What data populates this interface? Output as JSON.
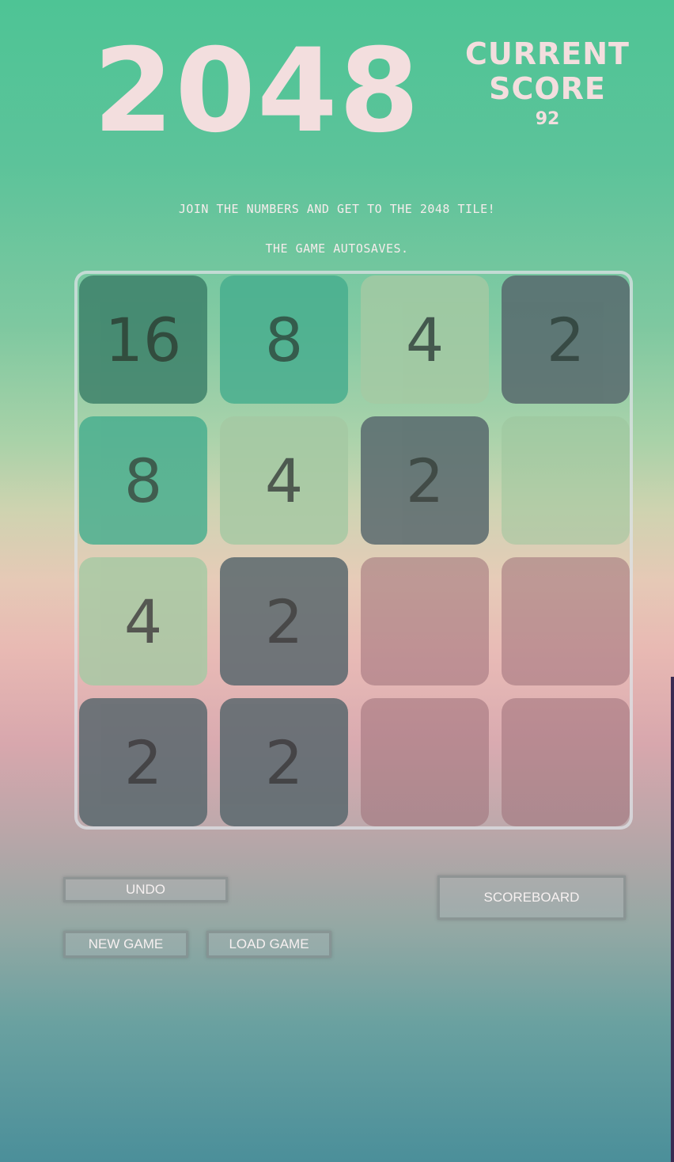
{
  "header": {
    "title": "2048",
    "score_label_line1": "CURRENT",
    "score_label_line2": "SCORE",
    "score_value": "92"
  },
  "info": {
    "line1": "JOIN THE NUMBERS AND GET TO THE 2048 TILE!",
    "line2": "THE GAME AUTOSAVES."
  },
  "board": {
    "size": 4,
    "rows": [
      [
        "16",
        "8",
        "4",
        "2"
      ],
      [
        "8",
        "4",
        "2",
        ""
      ],
      [
        "4",
        "2",
        "",
        ""
      ],
      [
        "2",
        "2",
        "",
        ""
      ]
    ],
    "tile_colors": {
      "2": "#55656b",
      "4": "#a5c9a3",
      "8": "#46ad8e",
      "16": "#3a7e68",
      "empty_top": "#9cc49c",
      "empty_bottom": "#9c6f78"
    }
  },
  "buttons": {
    "undo": "UNDO",
    "new_game": "NEW GAME",
    "load_game": "LOAD GAME",
    "scoreboard": "SCOREBOARD"
  }
}
